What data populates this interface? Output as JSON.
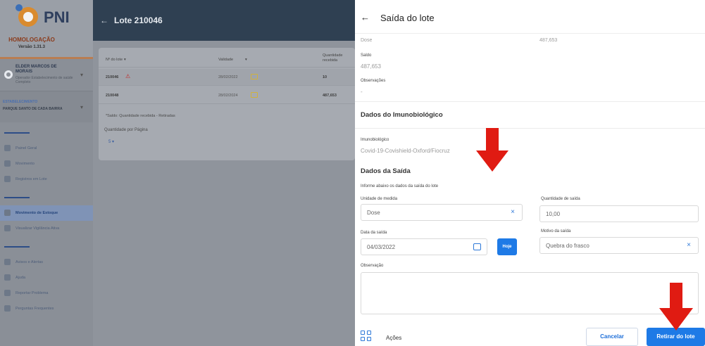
{
  "sidebar": {
    "app_name": "PNI",
    "environment": "HOMOLOGAÇÃO",
    "version": "Versão 1.31.3",
    "user_name": "ELDER MARCOS DE MORAIS",
    "user_sub": "Operador Estabelecimento de saúde Completo",
    "selected_label": "ESTABELECIMENTO",
    "selected_value": "PARQUE SANTO DE CADA BAIRRA",
    "nav": [
      {
        "label": "Painel Geral",
        "icon": "dashboard-icon"
      },
      {
        "label": "Movimento",
        "icon": "movement-icon"
      },
      {
        "label": "Registros em Lote",
        "icon": "batch-register-icon"
      },
      {
        "label": "Movimento de Estoque",
        "icon": "stock-icon"
      },
      {
        "label": "Visualizar Vigilância Ativa",
        "icon": "person-icon"
      },
      {
        "label": "Avisos e Alertas",
        "icon": "alert-icon"
      },
      {
        "label": "Ajuda",
        "icon": "help-icon"
      },
      {
        "label": "Reportar Problema",
        "icon": "report-icon"
      },
      {
        "label": "Perguntas Frequentes",
        "icon": "faq-icon"
      }
    ]
  },
  "main": {
    "title": "Lote 210046",
    "columns": [
      "Nº do lote",
      "Validade",
      "Quantidade recebida"
    ],
    "rows": [
      {
        "lote": "210046",
        "validade": "28/02/2022",
        "qtd": "10"
      },
      {
        "lote": "210048",
        "validade": "28/02/2024",
        "qtd": "487,653"
      }
    ],
    "note": "*Saldo: Quantidade recebida - Retiradas",
    "per_page_label": "Quantidade por Página",
    "per_page_value": "5"
  },
  "panel": {
    "title": "Saída do lote",
    "dose_label": "Dose",
    "dose_value": "487,653",
    "saldo_label": "Saldo",
    "saldo_value": "487,653",
    "obs_label": "Observações",
    "obs_value": "-",
    "imuno_section": "Dados do Imunobiológico",
    "imuno_label": "Imunobiológico",
    "imuno_value": "Covid-19-Covishield-Oxford/Fiocruz",
    "saida_section": "Dados da Saída",
    "saida_hint": "Informe abaixo os dados da saída do lote",
    "unidade_label": "Unidade de medida",
    "unidade_value": "Dose",
    "qtd_label": "Quantidade de saída",
    "qtd_value": "10,00",
    "data_label": "Data da saída",
    "data_value": "04/03/2022",
    "hoje_label": "Hoje",
    "motivo_label": "Motivo da saída",
    "motivo_value": "Quebra do frasco",
    "observacao_label": "Observação",
    "actions_label": "Ações",
    "cancel_label": "Cancelar",
    "submit_label": "Retirar do lote"
  },
  "colors": {
    "primary": "#1e7ae6",
    "annotation_arrow": "#e01b12"
  }
}
